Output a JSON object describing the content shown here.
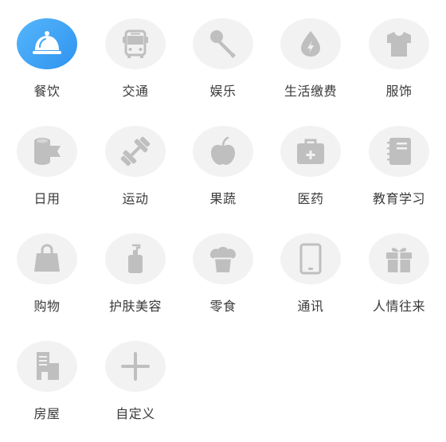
{
  "selected_index": 0,
  "categories": [
    {
      "label": "餐饮",
      "icon": "dining-cloche-icon"
    },
    {
      "label": "交通",
      "icon": "bus-icon"
    },
    {
      "label": "娱乐",
      "icon": "microphone-icon"
    },
    {
      "label": "生活缴费",
      "icon": "water-drop-bolt-icon"
    },
    {
      "label": "服饰",
      "icon": "tshirt-icon"
    },
    {
      "label": "日用",
      "icon": "paper-roll-icon"
    },
    {
      "label": "运动",
      "icon": "dumbbell-icon"
    },
    {
      "label": "果蔬",
      "icon": "apple-icon"
    },
    {
      "label": "医药",
      "icon": "medical-kit-icon"
    },
    {
      "label": "教育学习",
      "icon": "notebook-icon"
    },
    {
      "label": "购物",
      "icon": "shopping-bag-icon"
    },
    {
      "label": "护肤美容",
      "icon": "pump-bottle-icon"
    },
    {
      "label": "零食",
      "icon": "cupcake-icon"
    },
    {
      "label": "通讯",
      "icon": "tablet-icon"
    },
    {
      "label": "人情往来",
      "icon": "gift-icon"
    },
    {
      "label": "房屋",
      "icon": "building-icon"
    },
    {
      "label": "自定义",
      "icon": "plus-icon"
    }
  ],
  "colors": {
    "icon_gray": "#bfbfbf",
    "circle_bg": "#f2f2f2",
    "selected_bg": "#3fa9f5",
    "selected_icon": "#ffffff"
  }
}
